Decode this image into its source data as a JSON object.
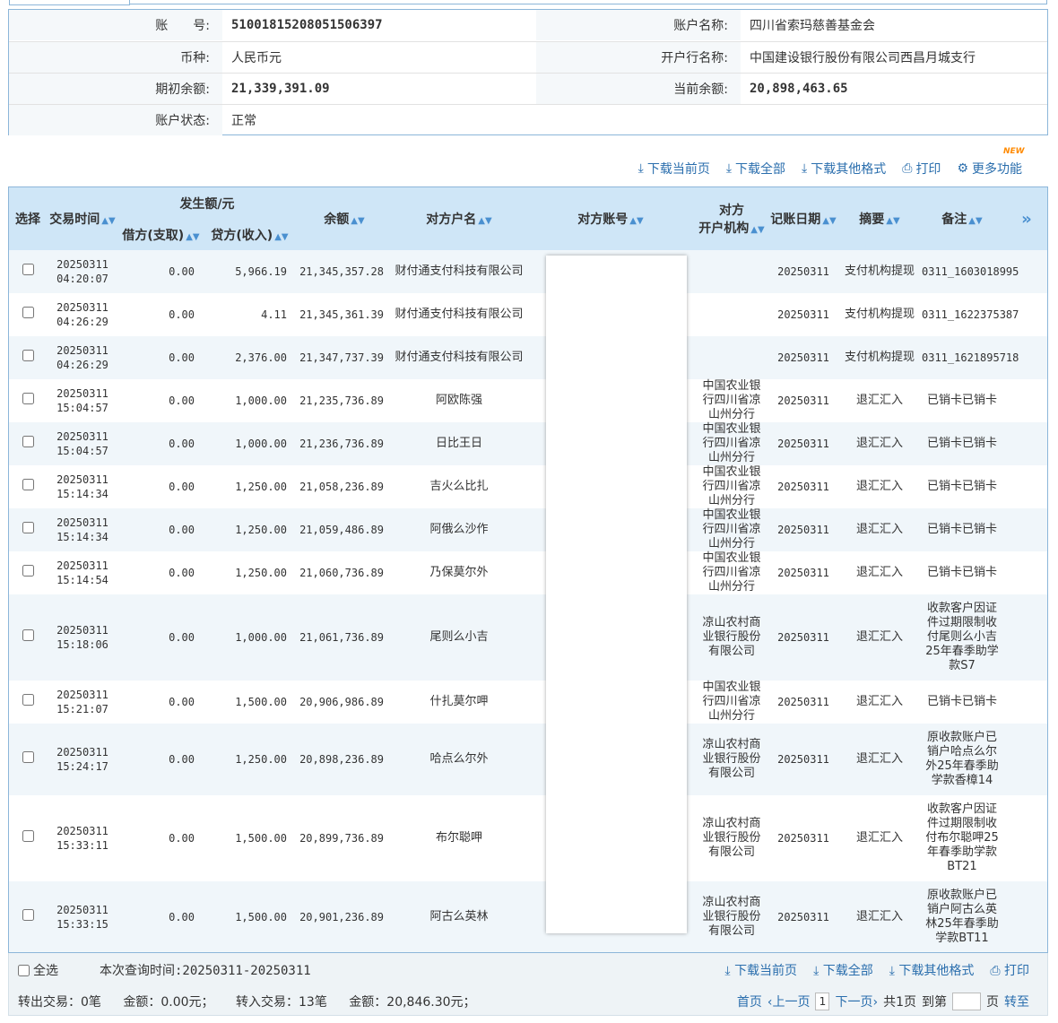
{
  "account": {
    "no_label": "账　　号:",
    "no_value": "51001815208051506397",
    "name_label": "账户名称:",
    "name_value": "四川省索玛慈善基金会",
    "currency_label": "币种:",
    "currency_value": "人民币元",
    "bank_label": "开户行名称:",
    "bank_value": "中国建设银行股份有限公司西昌月城支行",
    "opening_label": "期初余额:",
    "opening_value": "21,339,391.09",
    "current_label": "当前余额:",
    "current_value": "20,898,463.65",
    "status_label": "账户状态:",
    "status_value": "正常"
  },
  "toolbar": {
    "download_page": "下载当前页",
    "download_all": "下载全部",
    "download_other": "下载其他格式",
    "print": "打印",
    "more": "更多功能",
    "new_badge": "NEW"
  },
  "table": {
    "headers": {
      "select": "选择",
      "time": "交易时间",
      "amount": "发生额/元",
      "debit": "借方(支取)",
      "credit": "贷方(收入)",
      "balance": "余额",
      "party": "对方户名",
      "account": "对方账号",
      "bank_line1": "对方",
      "bank_line2": "开户机构",
      "date": "记账日期",
      "summary": "摘要",
      "note": "备注",
      "expand": "»"
    },
    "rows": [
      {
        "d": "20250311",
        "t": "04:20:07",
        "debit": "0.00",
        "credit": "5,966.19",
        "balance": "21,345,357.28",
        "party": "财付通支付科技有限公司",
        "bank": "",
        "date": "20250311",
        "summary": "支付机构提现",
        "note": "0311_1603018995",
        "mono": true
      },
      {
        "d": "20250311",
        "t": "04:26:29",
        "debit": "0.00",
        "credit": "4.11",
        "balance": "21,345,361.39",
        "party": "财付通支付科技有限公司",
        "bank": "",
        "date": "20250311",
        "summary": "支付机构提现",
        "note": "0311_1622375387",
        "mono": true
      },
      {
        "d": "20250311",
        "t": "04:26:29",
        "debit": "0.00",
        "credit": "2,376.00",
        "balance": "21,347,737.39",
        "party": "财付通支付科技有限公司",
        "bank": "",
        "date": "20250311",
        "summary": "支付机构提现",
        "note": "0311_1621895718",
        "mono": true
      },
      {
        "d": "20250311",
        "t": "15:04:57",
        "debit": "0.00",
        "credit": "1,000.00",
        "balance": "21,235,736.89",
        "party": "阿欧陈强",
        "bank": "中国农业银行四川省凉山州分行",
        "date": "20250311",
        "summary": "退汇汇入",
        "note": "已销卡已销卡"
      },
      {
        "d": "20250311",
        "t": "15:04:57",
        "debit": "0.00",
        "credit": "1,000.00",
        "balance": "21,236,736.89",
        "party": "日比王日",
        "bank": "中国农业银行四川省凉山州分行",
        "date": "20250311",
        "summary": "退汇汇入",
        "note": "已销卡已销卡"
      },
      {
        "d": "20250311",
        "t": "15:14:34",
        "debit": "0.00",
        "credit": "1,250.00",
        "balance": "21,058,236.89",
        "party": "吉火么比扎",
        "bank": "中国农业银行四川省凉山州分行",
        "date": "20250311",
        "summary": "退汇汇入",
        "note": "已销卡已销卡"
      },
      {
        "d": "20250311",
        "t": "15:14:34",
        "debit": "0.00",
        "credit": "1,250.00",
        "balance": "21,059,486.89",
        "party": "阿俄么沙作",
        "bank": "中国农业银行四川省凉山州分行",
        "date": "20250311",
        "summary": "退汇汇入",
        "note": "已销卡已销卡"
      },
      {
        "d": "20250311",
        "t": "15:14:54",
        "debit": "0.00",
        "credit": "1,250.00",
        "balance": "21,060,736.89",
        "party": "乃保莫尔外",
        "bank": "中国农业银行四川省凉山州分行",
        "date": "20250311",
        "summary": "退汇汇入",
        "note": "已销卡已销卡"
      },
      {
        "d": "20250311",
        "t": "15:18:06",
        "debit": "0.00",
        "credit": "1,000.00",
        "balance": "21,061,736.89",
        "party": "尾则么小吉",
        "bank": "凉山农村商业银行股份有限公司",
        "date": "20250311",
        "summary": "退汇汇入",
        "note": "收款客户因证件过期限制收付尾则么小吉25年春季助学款S7"
      },
      {
        "d": "20250311",
        "t": "15:21:07",
        "debit": "0.00",
        "credit": "1,500.00",
        "balance": "20,906,986.89",
        "party": "什扎莫尔呷",
        "bank": "中国农业银行四川省凉山州分行",
        "date": "20250311",
        "summary": "退汇汇入",
        "note": "已销卡已销卡"
      },
      {
        "d": "20250311",
        "t": "15:24:17",
        "debit": "0.00",
        "credit": "1,250.00",
        "balance": "20,898,236.89",
        "party": "哈点么尔外",
        "bank": "凉山农村商业银行股份有限公司",
        "date": "20250311",
        "summary": "退汇汇入",
        "note": "原收款账户已销户哈点么尔外25年春季助学款香樟14"
      },
      {
        "d": "20250311",
        "t": "15:33:11",
        "debit": "0.00",
        "credit": "1,500.00",
        "balance": "20,899,736.89",
        "party": "布尔聪呷",
        "bank": "凉山农村商业银行股份有限公司",
        "date": "20250311",
        "summary": "退汇汇入",
        "note": "收款客户因证件过期限制收付布尔聪呷25年春季助学款BT21"
      },
      {
        "d": "20250311",
        "t": "15:33:15",
        "debit": "0.00",
        "credit": "1,500.00",
        "balance": "20,901,236.89",
        "party": "阿古么英林",
        "bank": "凉山农村商业银行股份有限公司",
        "date": "20250311",
        "summary": "退汇汇入",
        "note": "原收款账户已销户阿古么英林25年春季助学款BT11"
      }
    ]
  },
  "footer": {
    "select_all": "全选",
    "query_time": "本次查询时间:20250311-20250311",
    "download_page": "下载当前页",
    "download_all": "下载全部",
    "download_other": "下载其他格式",
    "print": "打印",
    "out_count": "转出交易：0笔",
    "out_amount": "金额：0.00元；",
    "in_count": "转入交易：13笔",
    "in_amount": "金额：20,846.30元；",
    "first": "首页",
    "prev": "‹上一页",
    "page": "1",
    "next": "下一页›",
    "total": "共1页",
    "goto": "到第",
    "page_unit": "页",
    "go": "转至"
  },
  "colors": {
    "accent": "#2a6ead",
    "header_bg": "#cfe6f7",
    "border": "#8cb6d9",
    "badge": "#ff8a00"
  }
}
